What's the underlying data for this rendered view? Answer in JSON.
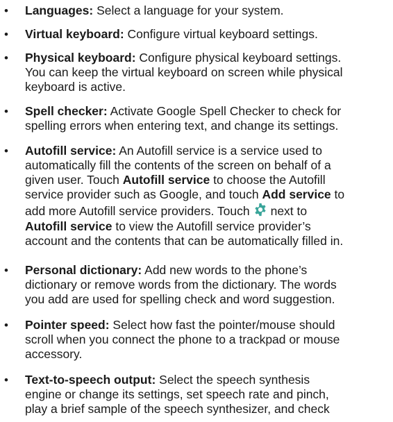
{
  "bullet_glyph": "•",
  "gear_color": "#3aa59a",
  "items": [
    {
      "term": "Languages:",
      "line1": " Select a language for your system."
    },
    {
      "term": "Virtual keyboard:",
      "line1": " Configure virtual keyboard settings."
    },
    {
      "term": "Physical keyboard:",
      "line1": " Configure physical keyboard settings.",
      "line2": "You can keep the virtual keyboard on screen while physical",
      "line3": "keyboard is active."
    },
    {
      "term": "Spell checker:",
      "line1": " Activate Google Spell Checker to check for",
      "line2": "spelling errors when entering text, and change its settings."
    },
    {
      "term": "Autofill service:",
      "line1": " An Autofill service is a service used to",
      "line2": "automatically fill the contents of the screen on behalf of a",
      "line3a": "given user. Touch ",
      "line3b": "Autofill service",
      "line3c": " to choose the Autofill",
      "line4a": "service provider such as Google, and touch ",
      "line4b": "Add service",
      "line4c": " to",
      "line5a": "add more Autofill service providers. Touch",
      "line5b": "next to",
      "line6a": "Autofill service",
      "line6b": " to view the Autofill service provider’s",
      "line7": "account and the contents that can be automatically filled in."
    },
    {
      "term": "Personal dictionary:",
      "line1": " Add new words to the phone’s",
      "line2": "dictionary or remove words from the dictionary. The words",
      "line3": "you add are used for spelling check and word suggestion."
    },
    {
      "term": "Pointer speed:",
      "line1": " Select how fast the pointer/mouse should",
      "line2": "scroll when you connect the phone to a trackpad or mouse",
      "line3": "accessory."
    },
    {
      "term": "Text-to-speech output:",
      "line1": " Select the speech synthesis",
      "line2": "engine or change its settings, set speech rate and pinch,",
      "line3": "play a brief sample of the speech synthesizer, and check"
    }
  ]
}
